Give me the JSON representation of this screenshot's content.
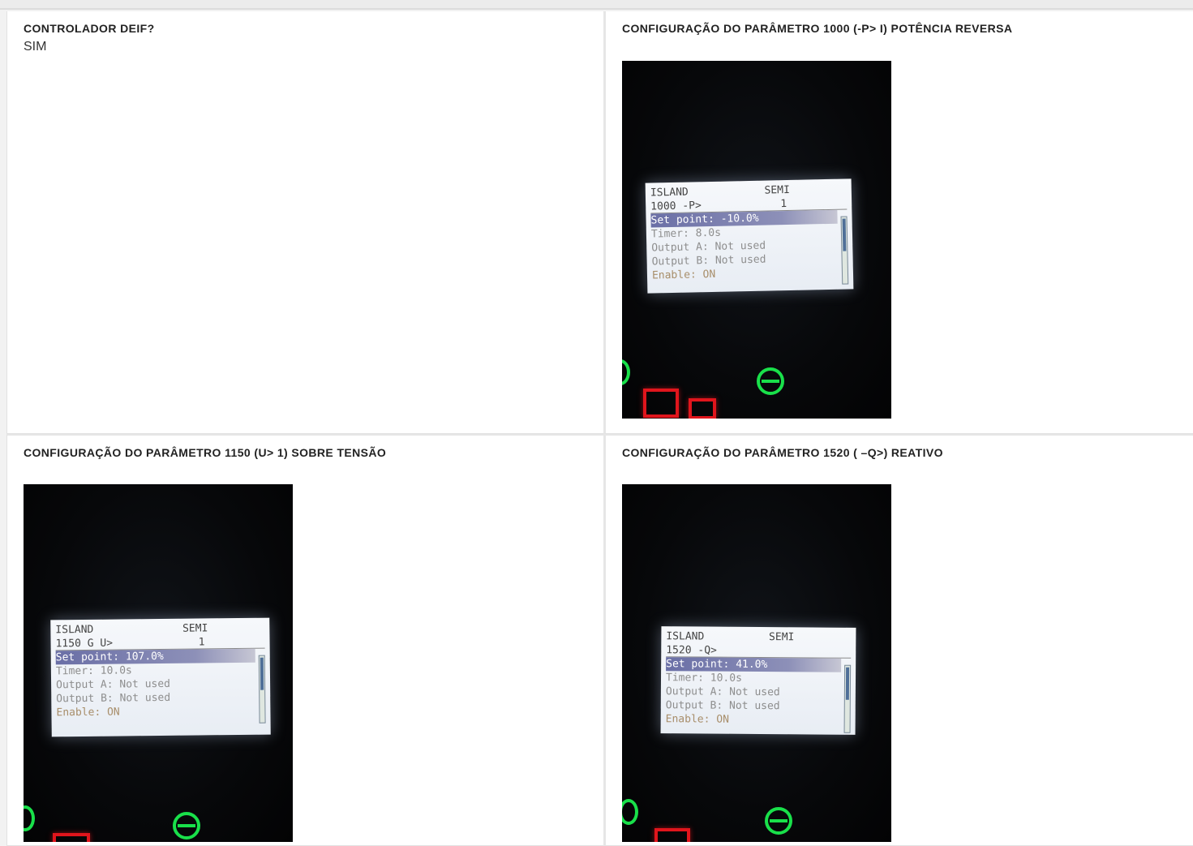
{
  "cells": [
    {
      "label": "CONTROLADOR DEIF?",
      "value": "SIM"
    },
    {
      "label": "CONFIGURAÇÃO DO PARÂMETRO 1000 (-P> I) POTÊNCIA REVERSA",
      "lcd": {
        "mode": "ISLAND",
        "state": "SEMI",
        "param": "1000 -P>",
        "index": "1",
        "setpoint": "Set point: -10.0%",
        "timer": "Timer:  8.0s",
        "out_a": "Output A: Not used",
        "out_b": "Output B: Not used",
        "enable": "Enable: ON"
      }
    },
    {
      "label": "CONFIGURAÇÃO DO PARÂMETRO 1150 (U> 1) SOBRE TENSÃO",
      "lcd": {
        "mode": "ISLAND",
        "state": "SEMI",
        "param": "1150 G  U>",
        "index": "1",
        "setpoint": "Set point:  107.0%",
        "timer": "Timer:  10.0s",
        "out_a": "Output A: Not used",
        "out_b": "Output B: Not used",
        "enable": "Enable: ON"
      }
    },
    {
      "label": "CONFIGURAÇÃO DO PARÂMETRO 1520 ( –Q>) REATIVO",
      "lcd": {
        "mode": "ISLAND",
        "state": "SEMI",
        "param": "1520 -Q>",
        "index": "",
        "setpoint": "Set point:  41.0%",
        "timer": "Timer:  10.0s",
        "out_a": "Output A: Not used",
        "out_b": "Output B: Not used",
        "enable": "Enable: ON"
      }
    }
  ]
}
